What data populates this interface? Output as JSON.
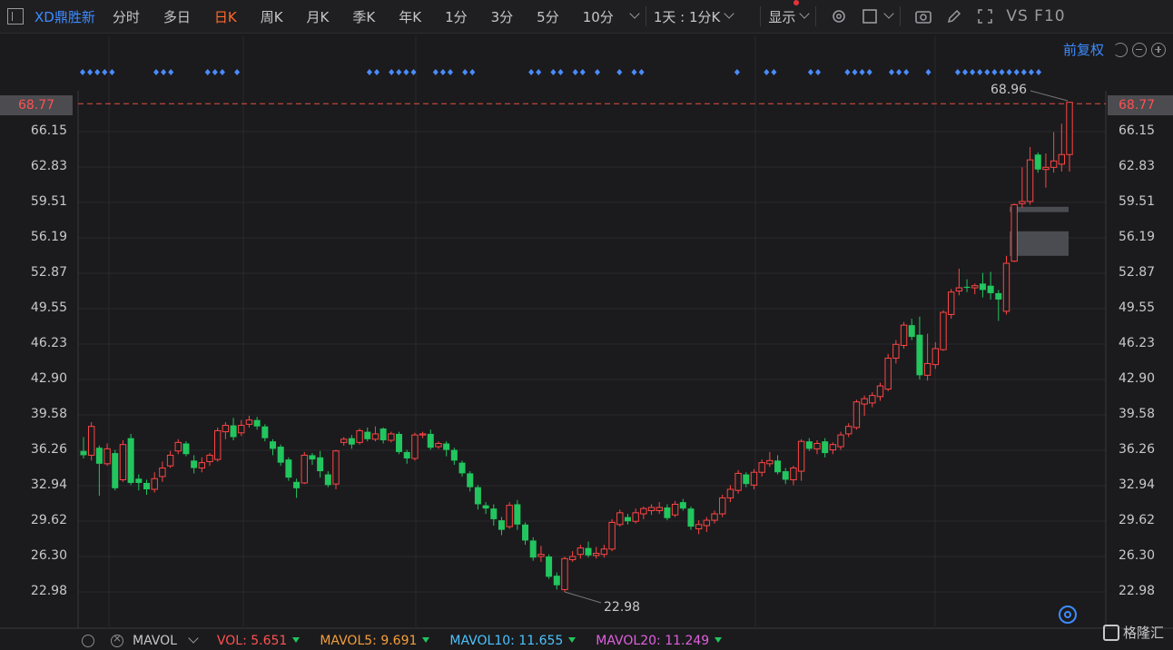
{
  "header": {
    "stock_name": "XD鼎胜新",
    "periods": [
      "分时",
      "多日",
      "日K",
      "周K",
      "月K",
      "季K",
      "年K",
      "1分",
      "3分",
      "5分",
      "10分"
    ],
    "active_period": "日K",
    "day_select": "1天 : 1分K",
    "display_label": "显示",
    "vs_f10": "VS F10"
  },
  "toolbar": {
    "fq_label": "前复权"
  },
  "axis": {
    "labels": [
      "66.15",
      "62.83",
      "59.51",
      "56.19",
      "52.87",
      "49.55",
      "46.23",
      "42.90",
      "39.58",
      "36.26",
      "32.94",
      "29.62",
      "26.30",
      "22.98"
    ],
    "top_partial": "69.47",
    "current_price": "68.77",
    "high_label": "68.96",
    "low_label": "22.98"
  },
  "colors": {
    "up": "#ff4545",
    "down": "#22c55e",
    "accent": "#3d8bff",
    "active": "#ff6a2a"
  },
  "indicator": {
    "name": "MAVOL",
    "vol": "VOL: 5.651",
    "mavol5": "MAVOL5: 9.691",
    "mavol10": "MAVOL10: 11.655",
    "mavol20": "MAVOL20: 11.249"
  },
  "brand": "格隆汇",
  "chart_data": {
    "type": "candlestick",
    "price_range": [
      22.98,
      69.47
    ],
    "candles": [
      [
        36.2,
        35.8,
        37.5,
        35.5
      ],
      [
        35.8,
        38.5,
        38.9,
        35.3
      ],
      [
        36.5,
        35.0,
        36.7,
        32.0
      ],
      [
        35.0,
        36.4,
        36.9,
        34.8
      ],
      [
        36.0,
        32.7,
        36.3,
        32.5
      ],
      [
        33.5,
        36.8,
        37.2,
        33.3
      ],
      [
        37.4,
        33.2,
        37.8,
        33.0
      ],
      [
        33.6,
        33.2,
        34.0,
        32.5
      ],
      [
        33.2,
        32.6,
        33.5,
        32.1
      ],
      [
        32.6,
        33.6,
        34.2,
        32.3
      ],
      [
        33.8,
        34.6,
        35.2,
        33.3
      ],
      [
        34.8,
        35.8,
        36.2,
        34.6
      ],
      [
        36.2,
        37.0,
        37.3,
        35.9
      ],
      [
        36.9,
        35.9,
        37.1,
        35.7
      ],
      [
        35.3,
        34.6,
        35.8,
        34.1
      ],
      [
        34.6,
        35.1,
        35.6,
        34.2
      ],
      [
        35.2,
        35.8,
        36.0,
        34.8
      ],
      [
        35.4,
        38.1,
        38.4,
        35.2
      ],
      [
        38.0,
        38.6,
        38.9,
        37.3
      ],
      [
        38.6,
        37.5,
        39.3,
        37.2
      ],
      [
        37.9,
        38.6,
        39.1,
        37.6
      ],
      [
        38.7,
        39.1,
        39.5,
        38.4
      ],
      [
        39.1,
        38.5,
        39.4,
        38.2
      ],
      [
        38.5,
        37.4,
        38.7,
        37.1
      ],
      [
        37.1,
        36.4,
        37.3,
        35.8
      ],
      [
        36.6,
        35.1,
        36.8,
        34.8
      ],
      [
        35.4,
        33.7,
        35.6,
        33.4
      ],
      [
        33.3,
        32.7,
        33.6,
        31.8
      ],
      [
        33.2,
        35.8,
        36.1,
        33.1
      ],
      [
        35.8,
        35.4,
        36.0,
        34.9
      ],
      [
        35.6,
        34.3,
        36.2,
        33.7
      ],
      [
        34.0,
        33.0,
        34.3,
        32.8
      ],
      [
        33.1,
        36.2,
        36.3,
        32.6
      ],
      [
        37.0,
        37.3,
        37.5,
        36.7
      ],
      [
        37.4,
        36.8,
        37.7,
        36.4
      ],
      [
        37.0,
        38.1,
        38.3,
        36.8
      ],
      [
        38.0,
        37.3,
        38.4,
        37.1
      ],
      [
        37.3,
        37.8,
        38.5,
        37.1
      ],
      [
        38.3,
        37.2,
        38.4,
        36.9
      ],
      [
        37.2,
        37.8,
        38.0,
        37.0
      ],
      [
        37.8,
        36.1,
        38.0,
        35.9
      ],
      [
        36.1,
        35.5,
        36.3,
        35.0
      ],
      [
        35.5,
        37.7,
        37.9,
        35.3
      ],
      [
        37.7,
        37.8,
        38.0,
        37.4
      ],
      [
        37.8,
        36.5,
        38.2,
        36.3
      ],
      [
        36.6,
        36.9,
        37.1,
        36.4
      ],
      [
        36.9,
        36.3,
        37.1,
        35.7
      ],
      [
        36.3,
        35.3,
        36.5,
        34.9
      ],
      [
        35.1,
        34.1,
        35.3,
        33.8
      ],
      [
        34.1,
        32.8,
        34.3,
        32.4
      ],
      [
        32.8,
        31.2,
        33.0,
        30.7
      ],
      [
        31.1,
        30.8,
        31.4,
        30.3
      ],
      [
        30.8,
        29.8,
        31.2,
        29.2
      ],
      [
        29.7,
        28.8,
        30.0,
        28.3
      ],
      [
        29.1,
        31.1,
        31.4,
        28.9
      ],
      [
        31.2,
        29.3,
        31.6,
        28.8
      ],
      [
        29.3,
        27.8,
        29.5,
        27.4
      ],
      [
        27.8,
        26.2,
        28.1,
        25.9
      ],
      [
        26.3,
        26.5,
        27.3,
        25.8
      ],
      [
        26.3,
        24.4,
        26.5,
        24.2
      ],
      [
        24.5,
        23.6,
        24.8,
        23.2
      ],
      [
        23.2,
        26.1,
        26.3,
        22.98
      ],
      [
        26.0,
        26.3,
        26.8,
        25.8
      ],
      [
        26.5,
        27.1,
        27.4,
        26.1
      ],
      [
        27.1,
        26.4,
        27.7,
        26.2
      ],
      [
        26.4,
        26.6,
        27.2,
        26.1
      ],
      [
        26.5,
        27.0,
        27.4,
        26.2
      ],
      [
        27.0,
        29.5,
        29.8,
        26.8
      ],
      [
        29.3,
        30.4,
        30.7,
        29.1
      ],
      [
        30.0,
        29.6,
        30.3,
        29.3
      ],
      [
        29.6,
        30.4,
        30.8,
        29.4
      ],
      [
        30.3,
        30.8,
        31.0,
        29.8
      ],
      [
        30.6,
        30.9,
        31.2,
        30.2
      ],
      [
        30.6,
        30.9,
        31.4,
        30.3
      ],
      [
        30.9,
        29.9,
        31.2,
        29.7
      ],
      [
        30.2,
        31.2,
        31.5,
        30.0
      ],
      [
        31.4,
        30.8,
        31.7,
        30.6
      ],
      [
        30.8,
        29.1,
        31.0,
        28.8
      ],
      [
        28.9,
        29.3,
        29.7,
        28.4
      ],
      [
        29.2,
        29.7,
        30.0,
        28.6
      ],
      [
        29.7,
        30.3,
        30.6,
        29.4
      ],
      [
        30.3,
        31.8,
        32.1,
        30.0
      ],
      [
        31.8,
        32.6,
        33.0,
        31.4
      ],
      [
        32.5,
        34.1,
        34.4,
        32.2
      ],
      [
        34.0,
        33.1,
        34.2,
        32.8
      ],
      [
        33.0,
        34.2,
        34.5,
        32.6
      ],
      [
        34.2,
        35.1,
        35.4,
        33.8
      ],
      [
        35.0,
        35.3,
        36.1,
        34.7
      ],
      [
        35.3,
        34.2,
        35.8,
        34.0
      ],
      [
        34.3,
        33.5,
        34.6,
        33.1
      ],
      [
        33.5,
        34.6,
        34.8,
        33.0
      ],
      [
        34.3,
        37.1,
        37.3,
        33.4
      ],
      [
        37.1,
        36.4,
        37.4,
        36.2
      ],
      [
        36.4,
        36.9,
        37.2,
        35.9
      ],
      [
        37.1,
        36.0,
        37.4,
        35.6
      ],
      [
        36.3,
        36.8,
        37.0,
        35.9
      ],
      [
        36.6,
        37.7,
        38.0,
        36.3
      ],
      [
        37.8,
        38.5,
        38.8,
        37.5
      ],
      [
        38.4,
        40.8,
        41.0,
        38.2
      ],
      [
        40.6,
        41.1,
        41.4,
        39.5
      ],
      [
        40.7,
        41.4,
        41.7,
        40.3
      ],
      [
        41.3,
        42.3,
        42.6,
        40.9
      ],
      [
        42.0,
        44.9,
        45.3,
        41.8
      ],
      [
        44.9,
        46.2,
        46.6,
        44.4
      ],
      [
        46.1,
        48.0,
        48.3,
        45.8
      ],
      [
        48.0,
        46.9,
        48.6,
        46.6
      ],
      [
        47.1,
        43.3,
        48.8,
        42.9
      ],
      [
        43.3,
        44.4,
        47.2,
        42.8
      ],
      [
        44.3,
        45.8,
        46.4,
        43.9
      ],
      [
        45.7,
        49.2,
        49.4,
        45.6
      ],
      [
        49.0,
        51.1,
        51.4,
        48.6
      ],
      [
        51.2,
        51.5,
        53.3,
        50.8
      ],
      [
        51.6,
        51.5,
        52.3,
        51.1
      ],
      [
        51.5,
        51.7,
        51.9,
        50.9
      ],
      [
        51.9,
        51.3,
        52.9,
        50.6
      ],
      [
        51.7,
        51.0,
        53.0,
        50.4
      ],
      [
        51.0,
        50.4,
        51.3,
        48.4
      ],
      [
        49.3,
        53.8,
        54.5,
        49.0
      ],
      [
        54.0,
        59.3,
        59.4,
        53.9
      ],
      [
        59.4,
        59.6,
        62.8,
        59.0
      ],
      [
        59.6,
        63.5,
        64.7,
        59.3
      ],
      [
        64.0,
        62.6,
        64.2,
        62.3
      ],
      [
        62.6,
        62.8,
        64.1,
        60.9
      ],
      [
        62.8,
        63.4,
        66.1,
        62.3
      ],
      [
        63.1,
        64.0,
        66.9,
        62.4
      ],
      [
        64.0,
        68.9,
        68.96,
        62.4
      ]
    ],
    "markers_row": "signal markers",
    "zones": [
      [
        54.5,
        56.8
      ],
      [
        58.6,
        59.1
      ]
    ]
  }
}
